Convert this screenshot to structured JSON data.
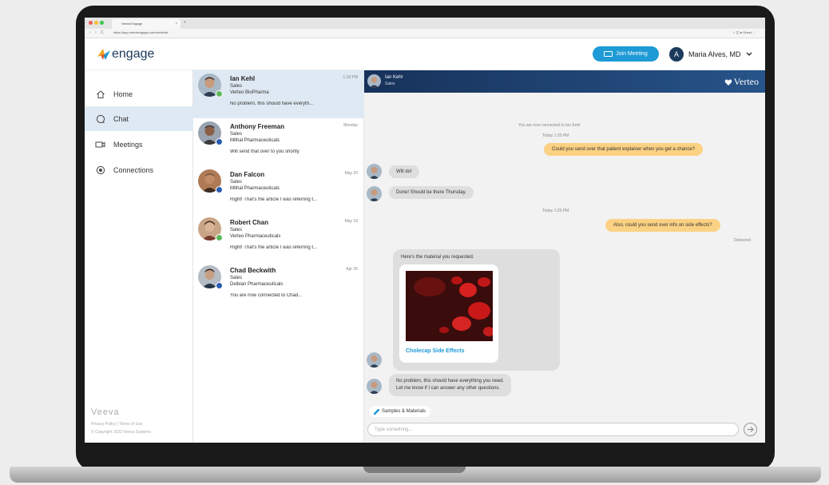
{
  "browser": {
    "tab_title": "Veeva Engage",
    "tab_close": "×",
    "new_tab": "+",
    "nav_arrows": "‹ › C",
    "url": "https://app.veevaengage.com/webchat",
    "toolbar_right": "☆ ◫ ● Guest ⋮"
  },
  "header": {
    "logo_text": "engage",
    "join_label": "Join Meeting",
    "user_initial": "A",
    "user_name": "Maria Alves, MD"
  },
  "sidebar": {
    "items": [
      {
        "label": "Home",
        "icon": "home-icon"
      },
      {
        "label": "Chat",
        "icon": "chat-icon"
      },
      {
        "label": "Meetings",
        "icon": "video-icon"
      },
      {
        "label": "Connections",
        "icon": "connections-icon"
      }
    ],
    "brand": "Veeva",
    "footer_links": "Privacy Policy  |  Terms of Use",
    "copyright": "© Copyright 2022 Veeva Systems"
  },
  "conversations": [
    {
      "name": "Ian Kehl",
      "time": "1:18 PM",
      "role": "Sales",
      "company": "Verteo BioPharma",
      "preview": "No problem, this should have everyth...",
      "badge": "#5cb85c"
    },
    {
      "name": "Anthony Freeman",
      "time": "Monday",
      "role": "Sales",
      "company": "Mithal Pharmaceuticals",
      "preview": "Will send that over to you shortly",
      "badge": "#2a5db0"
    },
    {
      "name": "Dan Falcon",
      "time": "May 20",
      "role": "Sales",
      "company": "Mithal Pharmaceuticals",
      "preview": "Right! That's the article I was referring t...",
      "badge": "#2a5db0"
    },
    {
      "name": "Robert Chan",
      "time": "May 18",
      "role": "Sales",
      "company": "Verteo Pharmaceuticals",
      "preview": "Right! That's the article I was referring t...",
      "badge": "#5cb85c"
    },
    {
      "name": "Chad Beckwith",
      "time": "Apr 26",
      "role": "Sales",
      "company": "Deibian Pharmaceuticals",
      "preview": "You are now connected to Chad...",
      "badge": "#2a5db0"
    }
  ],
  "chat": {
    "contact_name": "Ian Kehl",
    "contact_role": "Sales",
    "brand": "Verteo",
    "connected_note": "You are now connected to Ian Kehl",
    "time1": "Today 1:20 PM",
    "msg_out1": "Could you send over that patient explainer when you get a chance?",
    "msg_in1": "Will do!",
    "msg_in2": "Done! Should be there Thursday.",
    "time2": "Today 1:20 PM",
    "msg_out2": "Also, could you send over info on side effects?",
    "delivered": "Delivered",
    "material_intro": "Here's the material you requested.",
    "material_title": "Cholecap Side Effects",
    "msg_in3_line1": "No problem, this should have everything you need.",
    "msg_in3_line2": "Let me know if I can answer any other questions.",
    "samples_label": "Samples & Materials",
    "input_placeholder": "Type something..."
  },
  "colors": {
    "accent": "#1e9ad6",
    "header_navy": "#17325a",
    "outgoing_bubble": "#fbd183",
    "incoming_bubble": "#dedede",
    "active_bg": "#dfe9f3"
  }
}
